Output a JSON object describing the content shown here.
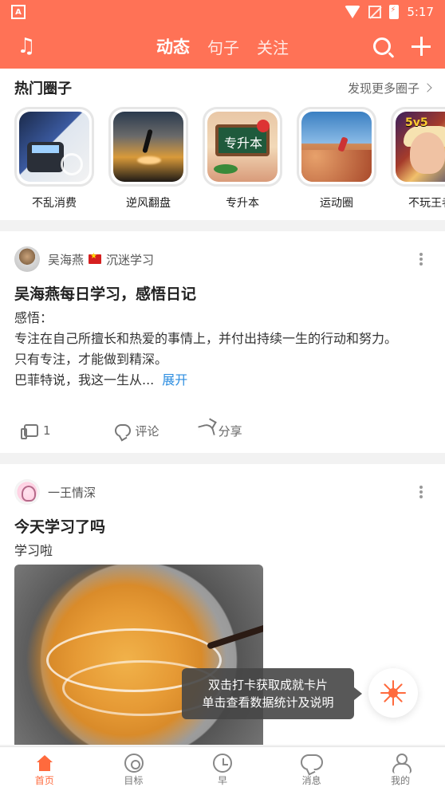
{
  "status_bar": {
    "time": "5:17",
    "app_badge": "A"
  },
  "top_bar": {
    "tabs": [
      {
        "label": "动态",
        "active": true
      },
      {
        "label": "句子",
        "active": false
      },
      {
        "label": "关注",
        "active": false
      }
    ],
    "icons": [
      "music-icon",
      "search-icon",
      "plus-icon"
    ]
  },
  "circles": {
    "title": "热门圈子",
    "more": "发现更多圈子",
    "items": [
      {
        "label": "不乱消费",
        "thumb": "payment-terminal"
      },
      {
        "label": "逆风翻盘",
        "thumb": "sunset-silhouette"
      },
      {
        "label": "专升本",
        "thumb": "chalkboard",
        "thumb_text": "专升本"
      },
      {
        "label": "运动圈",
        "thumb": "runner-on-rocks"
      },
      {
        "label": "不玩王者",
        "thumb": "game-hero",
        "thumb_text": "5v5"
      }
    ]
  },
  "posts": [
    {
      "author": "吴海燕",
      "topic": "沉迷学习",
      "title": "吴海燕每日学习，感悟日记",
      "body_lines": [
        "感悟：",
        "专注在自己所擅长和热爱的事情上，并付出持续一生的行动和努力。",
        "只有专注，才能做到精深。",
        "巴菲特说，我这一生从..."
      ],
      "expand": "展开",
      "actions": {
        "like_count": "1",
        "comment": "评论",
        "share": "分享"
      }
    },
    {
      "author": "一王情深",
      "title": "今天学习了吗",
      "body": "学习啦"
    }
  ],
  "tooltip": {
    "line1": "双击打卡获取成就卡片",
    "line2": "单击查看数据统计及说明"
  },
  "bottom_nav": [
    {
      "label": "首页",
      "active": true
    },
    {
      "label": "目标",
      "active": false
    },
    {
      "label": "早",
      "active": false
    },
    {
      "label": "消息",
      "active": false
    },
    {
      "label": "我的",
      "active": false
    }
  ],
  "colors": {
    "accent": "#ff7256",
    "active_nav": "#ff6a3d",
    "link": "#2c8de0"
  }
}
